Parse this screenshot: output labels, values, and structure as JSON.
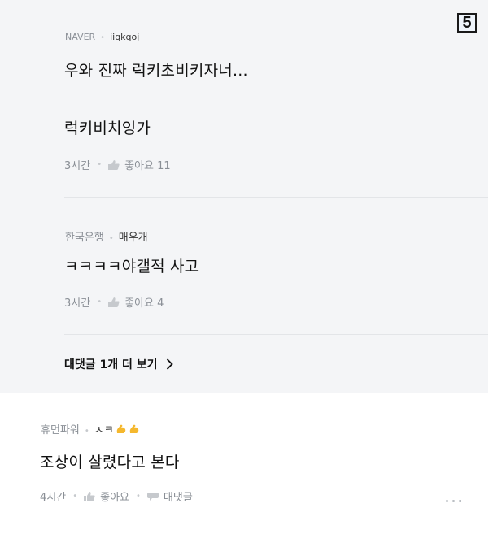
{
  "badge": "5",
  "replies": [
    {
      "source": "NAVER",
      "nickname": "iiqkqoj",
      "text_line1": "우와 진짜 럭키초비키자너...",
      "text_line2": "럭키비치잉가",
      "time": "3시간",
      "like_label": "좋아요 11"
    },
    {
      "source": "한국은행",
      "nickname": "매우개",
      "text_line1": "ㅋㅋㅋㅋ야갤적 사고",
      "time": "3시간",
      "like_label": "좋아요 4"
    }
  ],
  "more_replies_label": "대댓글 1개 더 보기",
  "comment": {
    "source": "휴먼파워",
    "nickname": "ㅅㅋ",
    "text": "조상이 살렸다고 본다",
    "time": "4시간",
    "like_label": "좋아요",
    "reply_label": "대댓글"
  },
  "icons": {
    "like": "thumbs-up-icon",
    "reply": "speech-bubble-icon",
    "chevron": "chevron-right-icon",
    "more": "more-horizontal-icon",
    "emoji": "flexed-biceps-emoji"
  },
  "colors": {
    "reply_background": "#f4f5f7",
    "meta_text": "#8a8f96",
    "emoji": "#f5b82e"
  }
}
